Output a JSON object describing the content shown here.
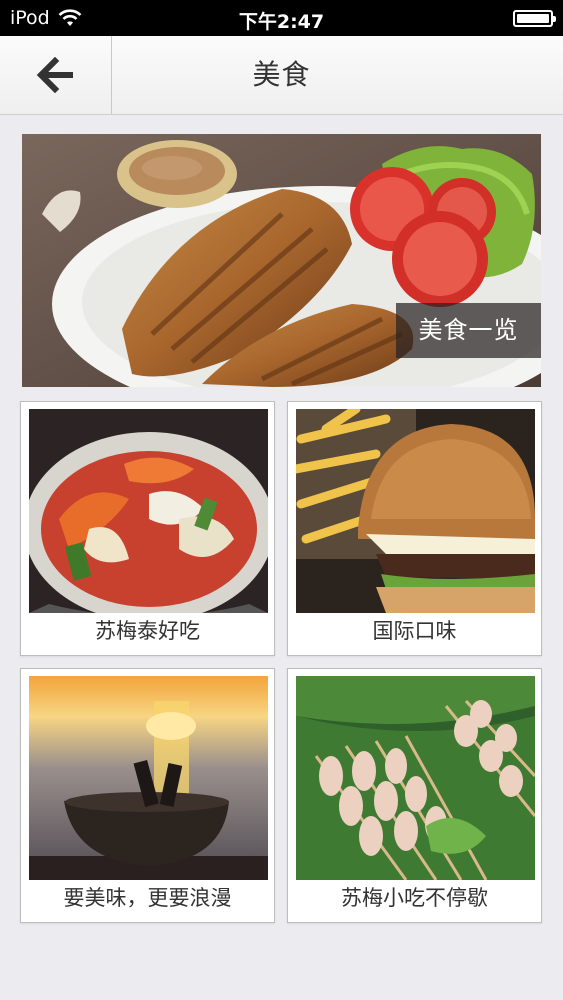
{
  "status_bar": {
    "carrier": "iPod",
    "time": "下午2:47"
  },
  "nav": {
    "title": "美食"
  },
  "hero": {
    "label": "美食一览"
  },
  "cards": [
    {
      "label": "苏梅泰好吃"
    },
    {
      "label": "国际口味"
    },
    {
      "label": "要美味，更要浪漫"
    },
    {
      "label": "苏梅小吃不停歇"
    }
  ]
}
